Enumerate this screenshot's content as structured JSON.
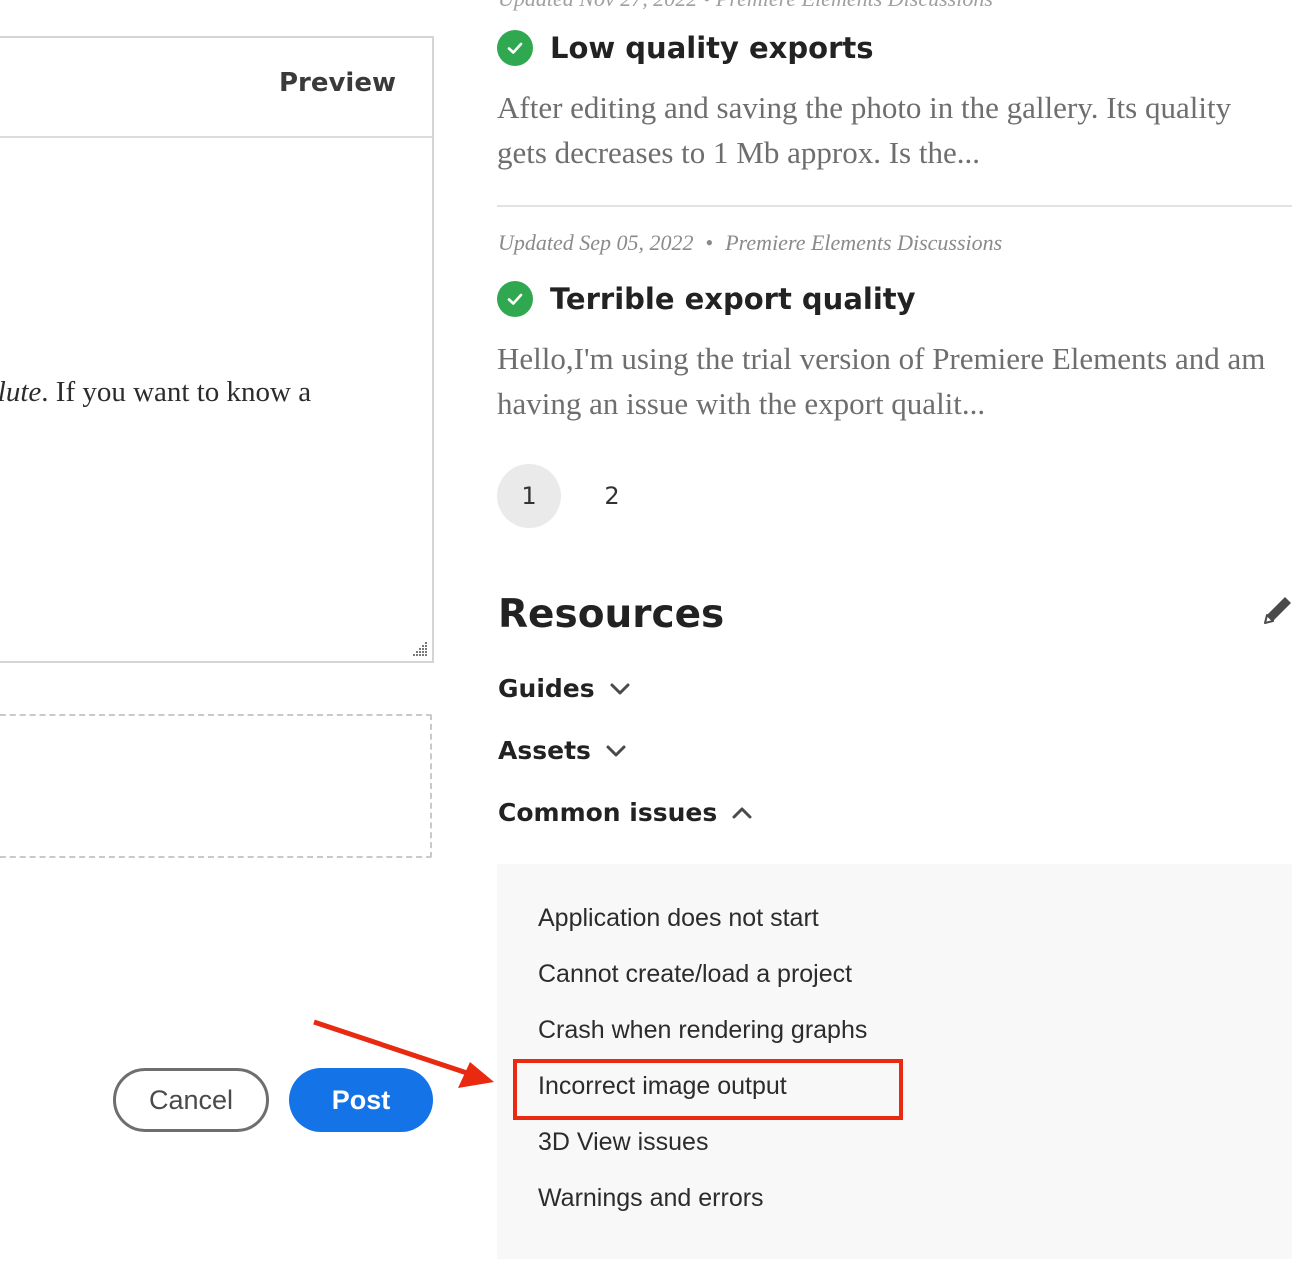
{
  "editor": {
    "preview_tab": "Preview",
    "text_italic": "solute",
    "text_rest": ". If you want to know a"
  },
  "actions": {
    "cancel_label": "Cancel",
    "post_label": "Post"
  },
  "posts": [
    {
      "title": "Low quality exports",
      "excerpt": "After editing and saving the photo in the gallery. Its quality gets decreases to 1 Mb approx. Is the...",
      "solved": true
    },
    {
      "meta_updated": "Updated Sep 05, 2022",
      "meta_board": "Premiere Elements Discussions",
      "title": "Terrible export quality",
      "excerpt": "Hello,I'm using the trial version of Premiere Elements and am having an issue with the export qualit...",
      "solved": true
    }
  ],
  "pagination": {
    "pages": [
      "1",
      "2"
    ],
    "current": "1"
  },
  "resources": {
    "title": "Resources",
    "sections": [
      {
        "label": "Guides",
        "expanded": false
      },
      {
        "label": "Assets",
        "expanded": false
      },
      {
        "label": "Common issues",
        "expanded": true
      }
    ],
    "common_issues": [
      "Application does not start",
      "Cannot create/load a project",
      "Crash when rendering graphs",
      "Incorrect image output",
      "3D View issues",
      "Warnings and errors"
    ]
  },
  "colors": {
    "accent": "#1473e6",
    "success": "#2fa84f",
    "annotation": "#ea2a10"
  }
}
